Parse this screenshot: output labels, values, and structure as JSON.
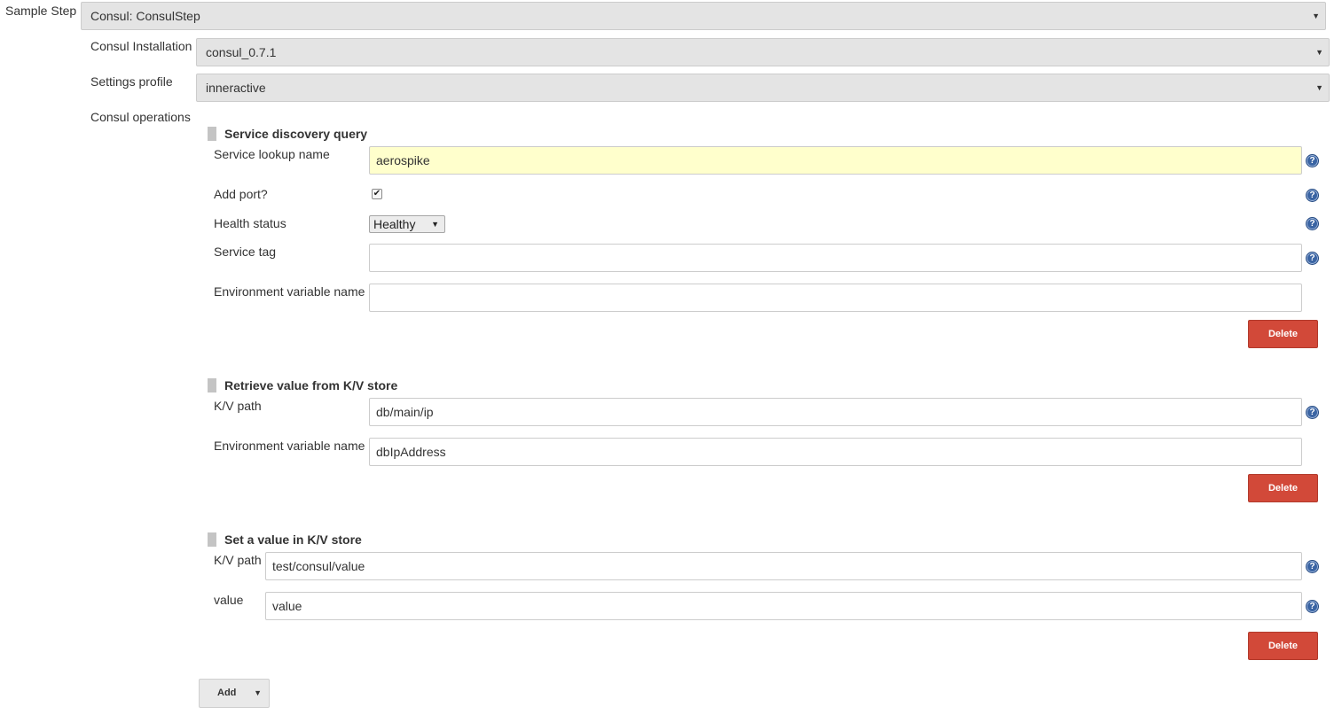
{
  "step": {
    "label": "Sample Step",
    "selected": "Consul: ConsulStep"
  },
  "installation": {
    "label": "Consul Installation",
    "selected": "consul_0.7.1"
  },
  "profile": {
    "label": "Settings profile",
    "selected": "inneractive"
  },
  "operations_label": "Consul operations",
  "discovery": {
    "title": "Service discovery query",
    "lookup_label": "Service lookup name",
    "lookup_value": "aerospike",
    "port_label": "Add port?",
    "port_checked": true,
    "health_label": "Health status",
    "health_selected": "Healthy",
    "tag_label": "Service tag",
    "tag_value": "",
    "env_label": "Environment variable name",
    "env_value": "",
    "delete_label": "Delete"
  },
  "kv_get": {
    "title": "Retrieve value from K/V store",
    "path_label": "K/V path",
    "path_value": "db/main/ip",
    "env_label": "Environment variable name",
    "env_value": "dbIpAddress",
    "delete_label": "Delete"
  },
  "kv_set": {
    "title": "Set a value in K/V store",
    "path_label": "K/V path",
    "path_value": "test/consul/value",
    "value_label": "value",
    "value_value": "value",
    "delete_label": "Delete"
  },
  "add_label": "Add",
  "icons": {
    "help": "question-mark-help-icon",
    "caret": "chevron-down-icon",
    "handle": "drag-handle-icon"
  },
  "colors": {
    "delete": "#d24939",
    "help": "#3a64a3",
    "highlight": "#ffffcc"
  }
}
